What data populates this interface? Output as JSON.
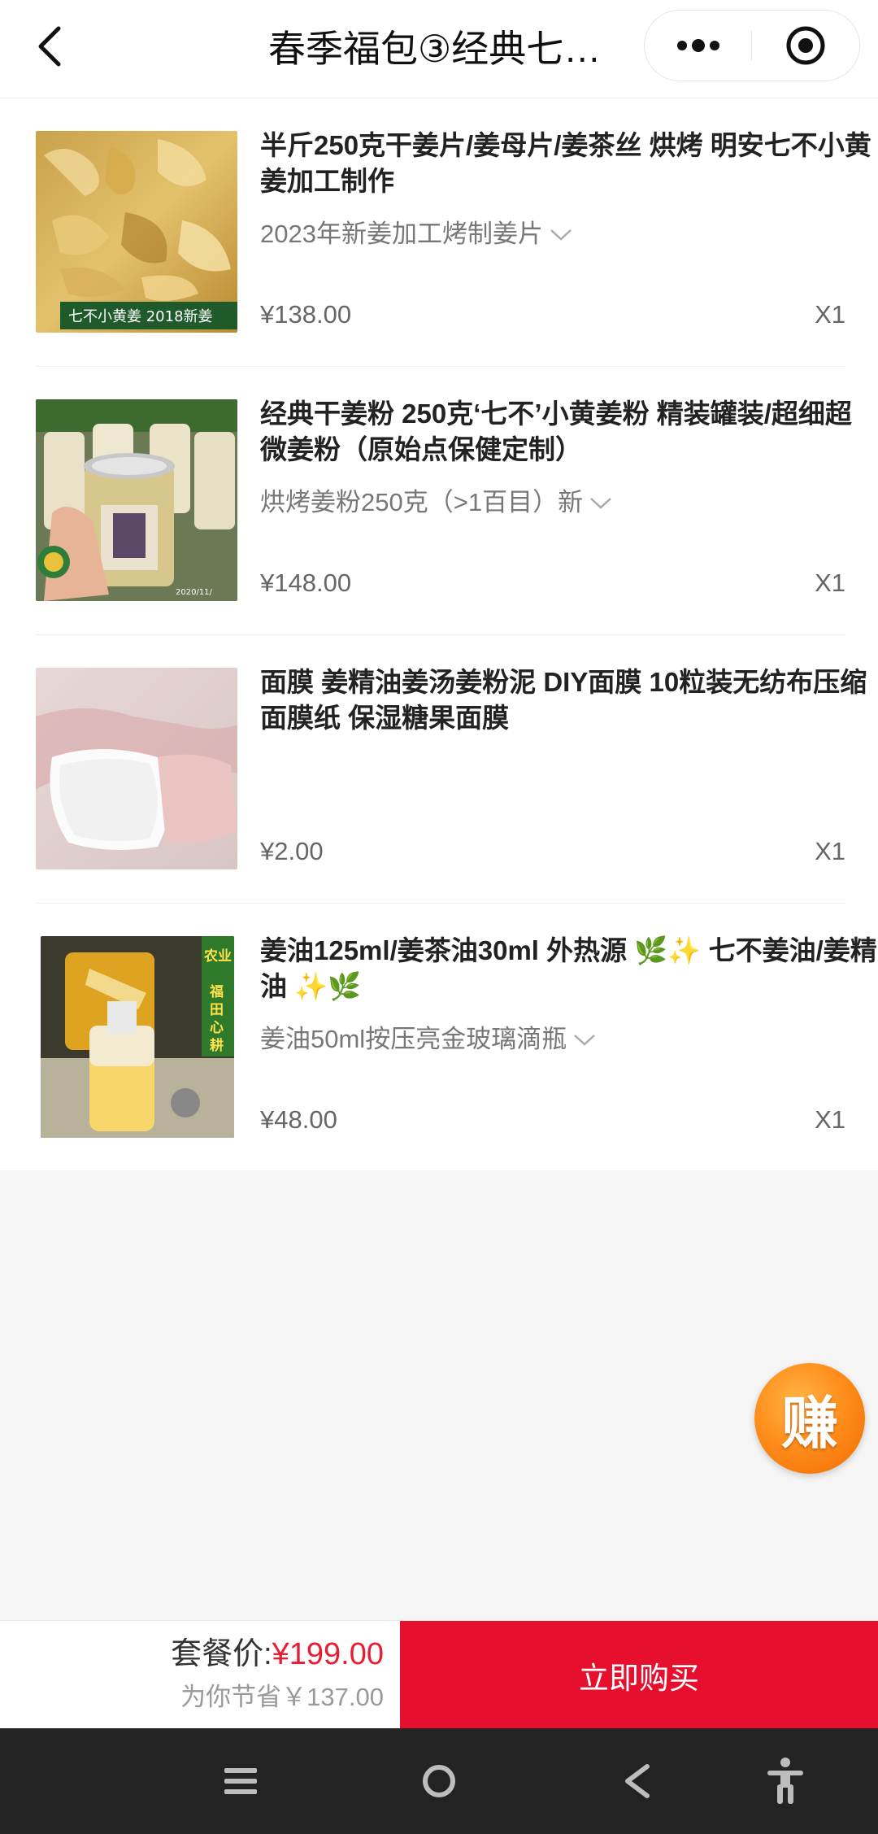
{
  "header": {
    "title": "春季福包③经典七…",
    "icons": [
      "back-icon",
      "more-icon",
      "close-miniprogram-icon"
    ]
  },
  "items": [
    {
      "title": "半斤250克干姜片/姜母片/姜茶丝 烘烤 明安七不小黄姜加工制作",
      "spec": "2023年新姜加工烤制姜片",
      "price": "¥138.00",
      "qty": "X1",
      "thumb_caption": "七不小黄姜 2018新姜"
    },
    {
      "title": "经典干姜粉 250克‘七不’小黄姜粉 精装罐装/超细超微姜粉（原始点保健定制）",
      "spec": "烘烤姜粉250克（>1百目）新",
      "price": "¥148.00",
      "qty": "X1"
    },
    {
      "title": "面膜 姜精油姜汤姜粉泥 DIY面膜 10粒装无纺布压缩面膜纸 保湿糖果面膜",
      "spec": "",
      "price": "¥2.00",
      "qty": "X1"
    },
    {
      "title": "姜油125ml/姜茶油30ml 外热源 🌿✨ 七不姜油/姜精油 ✨🌿",
      "spec": "姜油50ml按压亮金玻璃滴瓶",
      "price": "¥48.00",
      "qty": "X1",
      "thumb_caption_top": "农业",
      "thumb_caption_side": "福田心耕"
    }
  ],
  "earn_button": "赚",
  "footer": {
    "bundle_label": "套餐价:",
    "bundle_price": "¥199.00",
    "savings": "为你节省￥137.00",
    "buy_label": "立即购买"
  },
  "nav_bar": {
    "icons": [
      "menu-icon",
      "home-icon",
      "back-nav-icon",
      "accessibility-icon"
    ]
  },
  "colors": {
    "accent_red": "#e60f2e",
    "price_red": "#e81c32",
    "earn_orange": "#ff8f1c"
  }
}
